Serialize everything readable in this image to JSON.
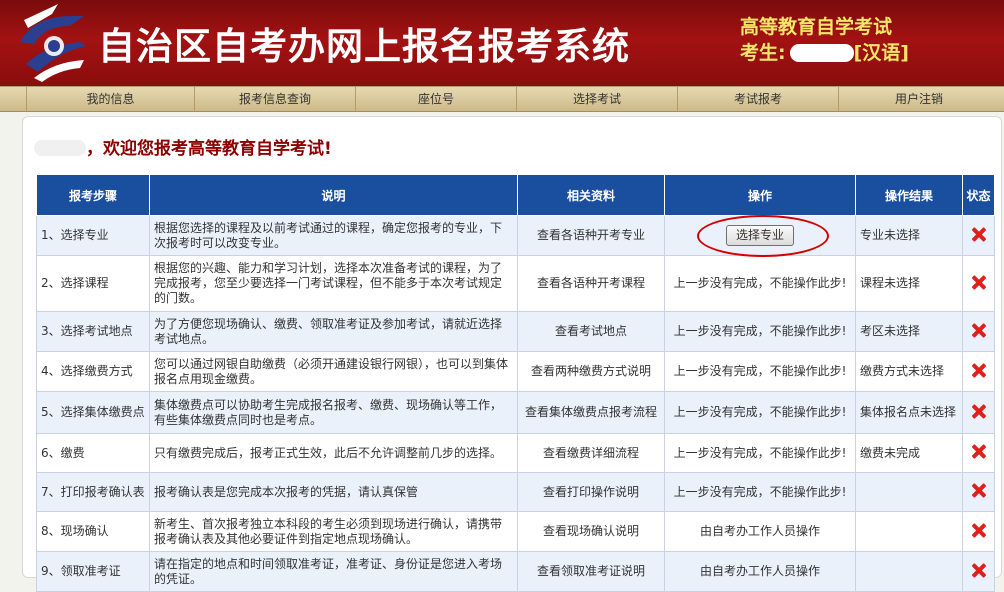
{
  "header": {
    "system_title": "自治区自考办网上报名报考系统",
    "exam_name": "高等教育自学考试",
    "examinee_label": "考生:",
    "language_tag": "[汉语]"
  },
  "nav": {
    "items": [
      "我的信息",
      "报考信息查询",
      "座位号",
      "选择考试",
      "考试报考",
      "用户注销"
    ]
  },
  "welcome": {
    "text": "，欢迎您报考高等教育自学考试!"
  },
  "table": {
    "headers": [
      "报考步骤",
      "说明",
      "相关资料",
      "操作",
      "操作结果",
      "状态"
    ],
    "rows": [
      {
        "step": "1、选择专业",
        "desc": "根据您选择的课程及以前考试通过的课程，确定您报考的专业，下次报考时可以改变专业。",
        "resource": "查看各语种开考专业",
        "op": "选择专业",
        "op_is_button": true,
        "result": "专业未选择"
      },
      {
        "step": "2、选择课程",
        "desc": "根据您的兴趣、能力和学习计划，选择本次准备考试的课程，为了完成报考，您至少要选择一门考试课程，但不能多于本次考试规定的门数。",
        "resource": "查看各语种开考课程",
        "op": "上一步没有完成，不能操作此步!",
        "op_is_button": false,
        "result": "课程未选择"
      },
      {
        "step": "3、选择考试地点",
        "desc": "为了方便您现场确认、缴费、领取准考证及参加考试，请就近选择考试地点。",
        "resource": "查看考试地点",
        "op": "上一步没有完成，不能操作此步!",
        "op_is_button": false,
        "result": "考区未选择"
      },
      {
        "step": "4、选择缴费方式",
        "desc": "您可以通过网银自助缴费（必须开通建设银行网银），也可以到集体报名点用现金缴费。",
        "resource": "查看两种缴费方式说明",
        "op": "上一步没有完成，不能操作此步!",
        "op_is_button": false,
        "result": "缴费方式未选择"
      },
      {
        "step": "5、选择集体缴费点",
        "desc": "集体缴费点可以协助考生完成报名报考、缴费、现场确认等工作，有些集体缴费点同时也是考点。",
        "resource": "查看集体缴费点报考流程",
        "op": "上一步没有完成，不能操作此步!",
        "op_is_button": false,
        "result": "集体报名点未选择"
      },
      {
        "step": "6、缴费",
        "desc": "只有缴费完成后，报考正式生效，此后不允许调整前几步的选择。",
        "resource": "查看缴费详细流程",
        "op": "上一步没有完成，不能操作此步!",
        "op_is_button": false,
        "result": "缴费未完成"
      },
      {
        "step": "7、打印报考确认表",
        "desc": "报考确认表是您完成本次报考的凭据，请认真保管",
        "resource": "查看打印操作说明",
        "op": "上一步没有完成，不能操作此步!",
        "op_is_button": false,
        "result": ""
      },
      {
        "step": "8、现场确认",
        "desc": "新考生、首次报考独立本科段的考生必须到现场进行确认，请携带报考确认表及其他必要证件到指定地点现场确认。",
        "resource": "查看现场确认说明",
        "op": "由自考办工作人员操作",
        "op_is_button": false,
        "result": ""
      },
      {
        "step": "9、领取准考证",
        "desc": "请在指定的地点和时间领取准考证，准考证、身份证是您进入考场的凭证。",
        "resource": "查看领取准考证说明",
        "op": "由自考办工作人员操作",
        "op_is_button": false,
        "result": ""
      }
    ]
  },
  "colors": {
    "header_red": "#a31212",
    "nav_tan": "#d8c79b",
    "table_header_blue": "#1a4fa0",
    "status_icon_red": "#e0201b",
    "highlight_ring": "#d40000"
  }
}
